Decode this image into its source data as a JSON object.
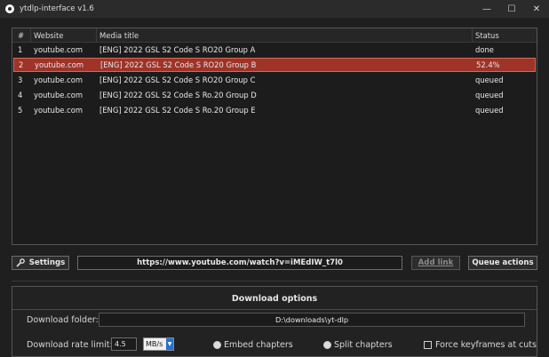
{
  "window": {
    "title": "ytdlp-interface v1.6"
  },
  "table": {
    "columns": [
      "#",
      "Website",
      "Media title",
      "Status"
    ],
    "rows": [
      {
        "num": "1",
        "site": "youtube.com",
        "title": "[ENG] 2022 GSL S2 Code S RO20 Group A",
        "status": "done"
      },
      {
        "num": "2",
        "site": "youtube.com",
        "title": "[ENG] 2022 GSL S2 Code S RO20 Group B",
        "status": "52.4%"
      },
      {
        "num": "3",
        "site": "youtube.com",
        "title": "[ENG] 2022 GSL S2 Code S RO20 Group C",
        "status": "queued"
      },
      {
        "num": "4",
        "site": "youtube.com",
        "title": "[ENG] 2022 GSL S2 Code S Ro.20 Group D",
        "status": "queued"
      },
      {
        "num": "5",
        "site": "youtube.com",
        "title": "[ENG] 2022 GSL S2 Code S Ro.20 Group E",
        "status": "queued"
      }
    ],
    "selected_row": 2,
    "selected_color": "#9e3328"
  },
  "toolbar": {
    "settings_label": "Settings",
    "url": "https://www.youtube.com/watch?v=iMEdIW_t7l0",
    "add_label": "Add link",
    "queue_label": "Queue actions"
  },
  "options": {
    "title": "Download options",
    "folder_label": "Download folder:",
    "folder_value": "D:\\downloads\\yt-dlp",
    "rate_label": "Download rate limit:",
    "rate_value": "4.5",
    "rate_unit": "MB/s",
    "embed_label": "Embed chapters",
    "split_label": "Split chapters",
    "keyframes_label": "Force keyframes at cuts"
  },
  "icons": {
    "settings": "wrench-icon",
    "app": "app-icon"
  }
}
